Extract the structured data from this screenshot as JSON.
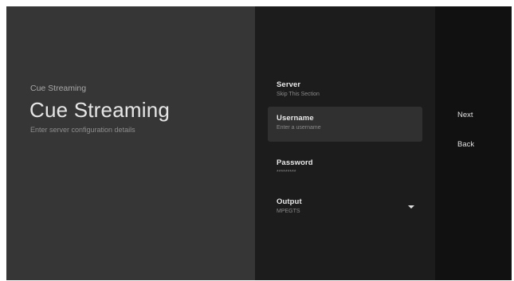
{
  "guidance": {
    "breadcrumb": "Cue Streaming",
    "title": "Cue Streaming",
    "description": "Enter server configuration details"
  },
  "form": {
    "fields": [
      {
        "title": "Server",
        "value": "Skip This Section"
      },
      {
        "title": "Username",
        "value": "Enter a username",
        "focused": true
      },
      {
        "title": "Password",
        "value": "*********"
      },
      {
        "title": "Output",
        "value": "MPEGTS",
        "icon": "chevron-down-icon"
      }
    ]
  },
  "actions": {
    "next_label": "Next",
    "back_label": "Back"
  },
  "colors": {
    "guidance_bg": "#363636",
    "form_bg": "#1c1c1c",
    "actions_bg": "#111111",
    "focus_bg": "#303030"
  }
}
